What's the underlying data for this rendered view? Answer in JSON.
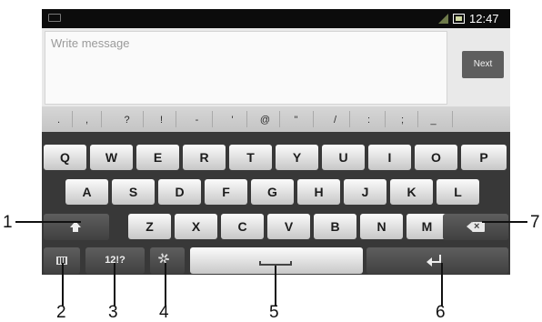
{
  "status_bar": {
    "time": "12:47 am",
    "icons": [
      "keyboard-notification-icon",
      "signal-icon",
      "battery-icon"
    ]
  },
  "compose": {
    "placeholder": "Write message",
    "next_button": "Next"
  },
  "keyboard": {
    "symbols": [
      ".",
      ",",
      "?",
      "!",
      "-",
      "'",
      "@",
      "\"",
      "/",
      ":",
      ";",
      "_"
    ],
    "row1": [
      "Q",
      "W",
      "E",
      "R",
      "T",
      "Y",
      "U",
      "I",
      "O",
      "P"
    ],
    "row2": [
      "A",
      "S",
      "D",
      "F",
      "G",
      "H",
      "J",
      "K",
      "L"
    ],
    "row3": [
      "Z",
      "X",
      "C",
      "V",
      "B",
      "N",
      "M"
    ],
    "bottom": {
      "settings_icon": "keyboard-settings-icon",
      "numbers_label": "12!?",
      "smiley_icon": "magic-wand-icon",
      "space_icon": "space-icon",
      "enter_icon": "enter-icon"
    },
    "shift_icon": "shift-arrow-icon",
    "backspace_icon": "backspace-icon"
  },
  "callouts": [
    "1",
    "2",
    "3",
    "4",
    "5",
    "6",
    "7"
  ],
  "colors": {
    "keyboard_bg": "#383838",
    "letter_key": "#e6e6e6",
    "function_key": "#4e4e4e",
    "status_bar": "#0c0c0c"
  }
}
